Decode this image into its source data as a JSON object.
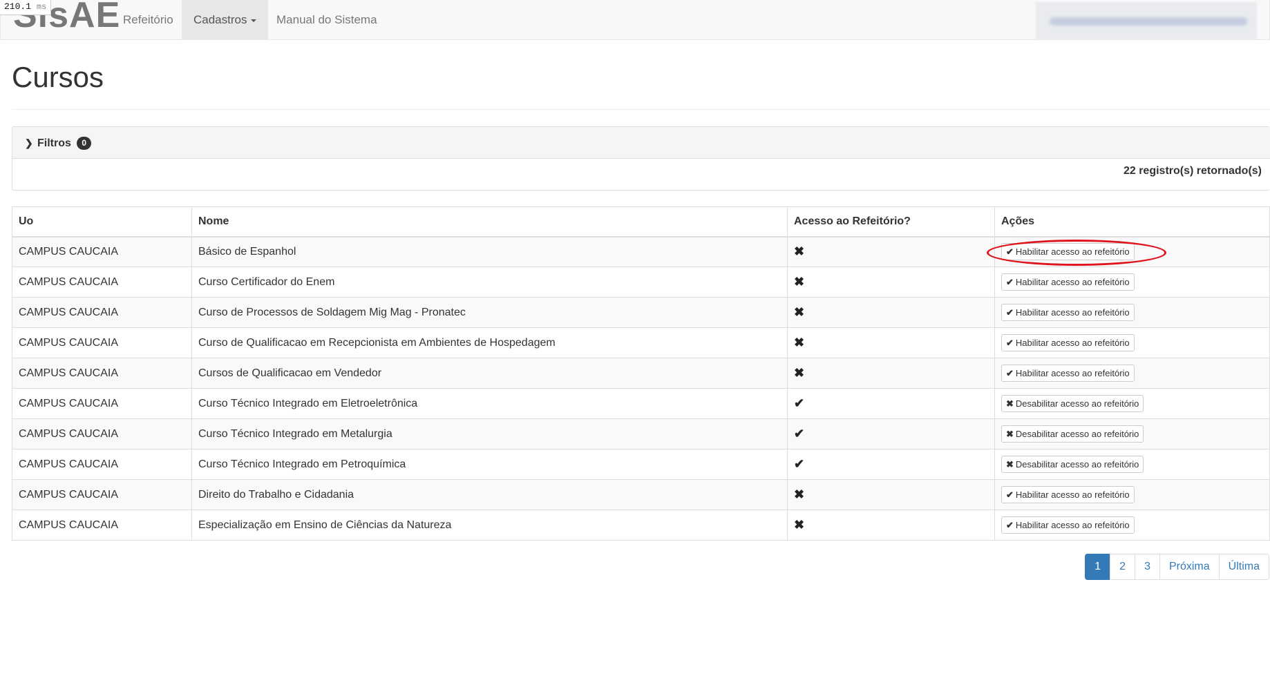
{
  "timing": {
    "value": "210.1",
    "unit": "ms"
  },
  "navbar": {
    "brand": "SisAE",
    "items": [
      {
        "label": "Refeitório"
      },
      {
        "label": "Cadastros"
      },
      {
        "label": "Manual do Sistema"
      }
    ]
  },
  "page": {
    "title": "Cursos"
  },
  "filters": {
    "label": "Filtros",
    "badge": "0",
    "count_text": "22 registro(s) retornado(s)"
  },
  "table": {
    "headers": [
      "Uo",
      "Nome",
      "Acesso ao Refeitório?",
      "Ações"
    ],
    "rows": [
      {
        "uo": "CAMPUS CAUCAIA",
        "nome": "Básico de Espanhol",
        "acesso": "✖",
        "acao": "Habilitar acesso ao refeitório",
        "acao_icon": "✔"
      },
      {
        "uo": "CAMPUS CAUCAIA",
        "nome": "Curso Certificador do Enem",
        "acesso": "✖",
        "acao": "Habilitar acesso ao refeitório",
        "acao_icon": "✔"
      },
      {
        "uo": "CAMPUS CAUCAIA",
        "nome": "Curso de Processos de Soldagem Mig Mag - Pronatec",
        "acesso": "✖",
        "acao": "Habilitar acesso ao refeitório",
        "acao_icon": "✔"
      },
      {
        "uo": "CAMPUS CAUCAIA",
        "nome": "Curso de Qualificacao em Recepcionista em Ambientes de Hospedagem",
        "acesso": "✖",
        "acao": "Habilitar acesso ao refeitório",
        "acao_icon": "✔"
      },
      {
        "uo": "CAMPUS CAUCAIA",
        "nome": "Cursos de Qualificacao em Vendedor",
        "acesso": "✖",
        "acao": "Habilitar acesso ao refeitório",
        "acao_icon": "✔"
      },
      {
        "uo": "CAMPUS CAUCAIA",
        "nome": "Curso Técnico Integrado em Eletroeletrônica",
        "acesso": "✔",
        "acao": "Desabilitar acesso ao refeitório",
        "acao_icon": "✖"
      },
      {
        "uo": "CAMPUS CAUCAIA",
        "nome": "Curso Técnico Integrado em Metalurgia",
        "acesso": "✔",
        "acao": "Desabilitar acesso ao refeitório",
        "acao_icon": "✖"
      },
      {
        "uo": "CAMPUS CAUCAIA",
        "nome": "Curso Técnico Integrado em Petroquímica",
        "acesso": "✔",
        "acao": "Desabilitar acesso ao refeitório",
        "acao_icon": "✖"
      },
      {
        "uo": "CAMPUS CAUCAIA",
        "nome": "Direito do Trabalho e Cidadania",
        "acesso": "✖",
        "acao": "Habilitar acesso ao refeitório",
        "acao_icon": "✔"
      },
      {
        "uo": "CAMPUS CAUCAIA",
        "nome": "Especialização em Ensino de Ciências da Natureza",
        "acesso": "✖",
        "acao": "Habilitar acesso ao refeitório",
        "acao_icon": "✔"
      }
    ]
  },
  "pagination": {
    "pages": [
      "1",
      "2",
      "3"
    ],
    "next": "Próxima",
    "last": "Última",
    "current": "1"
  },
  "colors": {
    "accent": "#337ab7",
    "highlight": "#e0141c"
  }
}
